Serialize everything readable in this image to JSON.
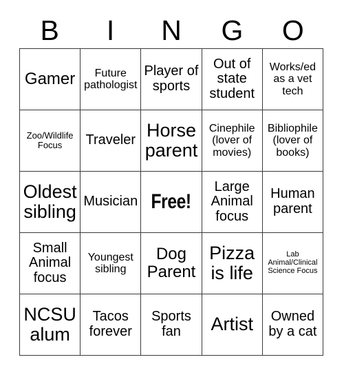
{
  "header": {
    "letters": [
      "B",
      "I",
      "N",
      "G",
      "O"
    ]
  },
  "grid": {
    "rows": [
      [
        {
          "text": "Gamer",
          "size": "lg",
          "free": false
        },
        {
          "text": "Future pathologist",
          "size": "sm",
          "free": false
        },
        {
          "text": "Player of sports",
          "size": "md",
          "free": false
        },
        {
          "text": "Out of state student",
          "size": "md",
          "free": false
        },
        {
          "text": "Works/ed as a vet tech",
          "size": "sm",
          "free": false
        }
      ],
      [
        {
          "text": "Zoo/Wildlife Focus",
          "size": "xs",
          "free": false
        },
        {
          "text": "Traveler",
          "size": "md",
          "free": false
        },
        {
          "text": "Horse parent",
          "size": "xl",
          "free": false
        },
        {
          "text": "Cinephile (lover of movies)",
          "size": "sm",
          "free": false
        },
        {
          "text": "Bibliophile (lover of books)",
          "size": "sm",
          "free": false
        }
      ],
      [
        {
          "text": "Oldest sibling",
          "size": "xl",
          "free": false
        },
        {
          "text": "Musician",
          "size": "md",
          "free": false
        },
        {
          "text": "Free!",
          "size": "lg",
          "free": true
        },
        {
          "text": "Large Animal focus",
          "size": "md",
          "free": false
        },
        {
          "text": "Human parent",
          "size": "md",
          "free": false
        }
      ],
      [
        {
          "text": "Small Animal focus",
          "size": "md",
          "free": false
        },
        {
          "text": "Youngest sibling",
          "size": "sm",
          "free": false
        },
        {
          "text": "Dog Parent",
          "size": "lg",
          "free": false
        },
        {
          "text": "Pizza is life",
          "size": "xl",
          "free": false
        },
        {
          "text": "Lab Animal/Clinical Science Focus",
          "size": "xxs",
          "free": false
        }
      ],
      [
        {
          "text": "NCSU alum",
          "size": "xl",
          "free": false
        },
        {
          "text": "Tacos forever",
          "size": "md",
          "free": false
        },
        {
          "text": "Sports fan",
          "size": "md",
          "free": false
        },
        {
          "text": "Artist",
          "size": "xl",
          "free": false
        },
        {
          "text": "Owned by a cat",
          "size": "md",
          "free": false
        }
      ]
    ]
  }
}
